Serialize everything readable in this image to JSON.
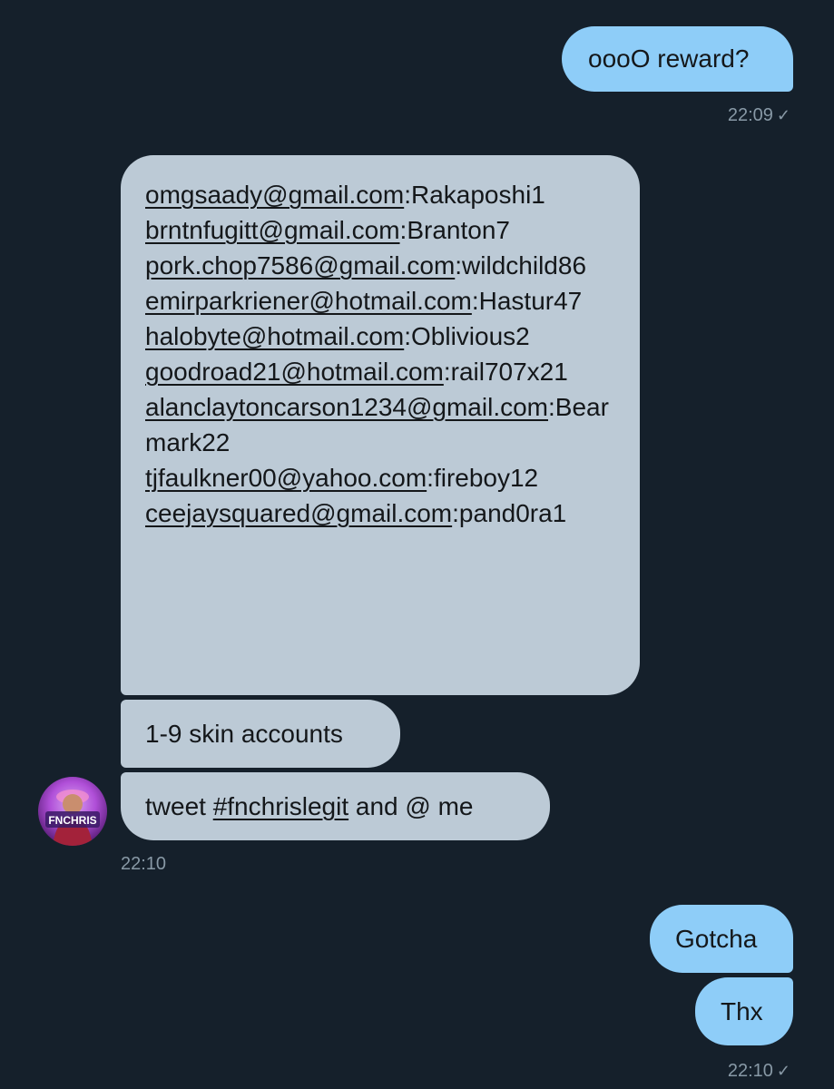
{
  "conversation": {
    "messages": [
      {
        "id": "m1",
        "direction": "out",
        "text": "oooO reward?",
        "time": "22:09"
      },
      {
        "id": "m2",
        "direction": "in",
        "credentials": [
          {
            "email": "omgsaady@gmail.com",
            "sep": ":",
            "password": "Rakaposhi1"
          },
          {
            "email": "brntnfugitt@gmail.com",
            "sep": ":",
            "password": "Branton7"
          },
          {
            "email": "pork.chop7586@gmail.com",
            "sep": ":",
            "password": "wildchild86"
          },
          {
            "email": "emirparkriener@hotmail.com",
            "sep": ":",
            "password": "Hastur47"
          },
          {
            "email": "halobyte@hotmail.com",
            "sep": ":",
            "password": "Oblivious2"
          },
          {
            "email": "goodroad21@hotmail.com",
            "sep": ":",
            "password": "rail707x21"
          },
          {
            "email": "alanclaytoncarson1234@gmail.com",
            "sep": ":",
            "password": "Bearmark22"
          },
          {
            "email": "tjfaulkner00@yahoo.com",
            "sep": ":",
            "password": "fireboy12"
          },
          {
            "email": "ceejaysquared@gmail.com",
            "sep": ":",
            "password": "pand0ra1"
          }
        ]
      },
      {
        "id": "m3",
        "direction": "in",
        "text": "1-9 skin accounts"
      },
      {
        "id": "m4",
        "direction": "in",
        "prefix": "tweet ",
        "hashtag": "#fnchrislegit",
        "suffix": " and @ me",
        "time": "22:10"
      },
      {
        "id": "m5",
        "direction": "out",
        "text": "Gotcha"
      },
      {
        "id": "m6",
        "direction": "out",
        "text": "Thx",
        "time": "22:10"
      }
    ],
    "avatar": {
      "label": "FNCHRIS"
    },
    "read_check": "✓",
    "colors": {
      "background": "#15202b",
      "outgoing_bubble": "#8ecdf8",
      "incoming_bubble": "#bccad6",
      "timestamp": "#8899a6"
    }
  }
}
